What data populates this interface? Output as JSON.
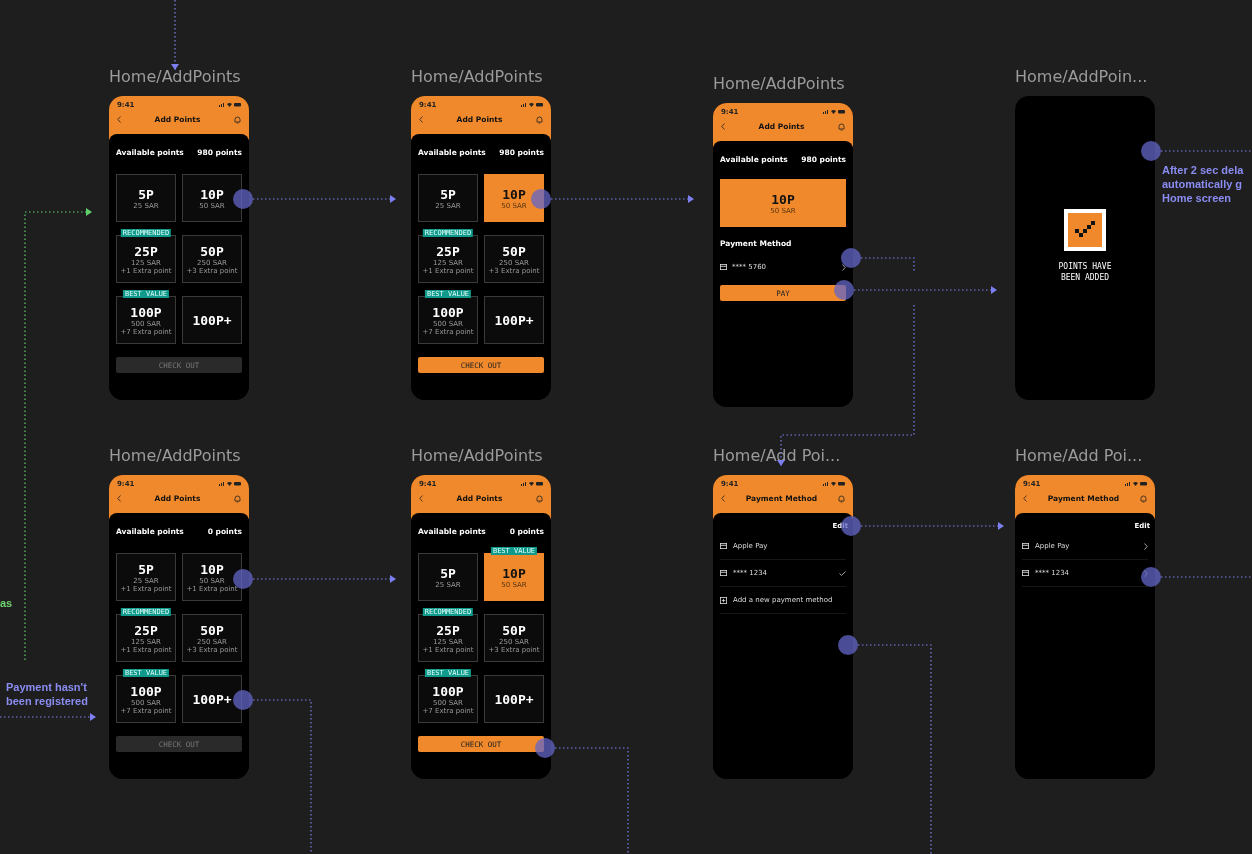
{
  "frames": [
    {
      "title": "Home/AddPoints",
      "kind": "packages",
      "time": "9:41",
      "header": "Add Points",
      "balance_label": "Available points",
      "balance": "980 points",
      "packages": [
        {
          "points": "5P",
          "price": "25 SAR",
          "selected": false
        },
        {
          "points": "10P",
          "price": "50 SAR",
          "selected": false
        },
        {
          "points": "25P",
          "price": "125 SAR",
          "extra": "+1 Extra point",
          "badge": "RECOMMENDED",
          "selected": false
        },
        {
          "points": "50P",
          "price": "250 SAR",
          "extra": "+3 Extra point",
          "selected": false
        },
        {
          "points": "100P",
          "price": "500 SAR",
          "extra": "+7 Extra point",
          "badge": "BEST VALUE",
          "selected": false
        },
        {
          "points": "100P+",
          "selected": false
        }
      ],
      "action": {
        "label": "CHECK OUT",
        "disabled": true
      }
    },
    {
      "title": "Home/AddPoints",
      "kind": "packages",
      "time": "9:41",
      "header": "Add Points",
      "balance_label": "Available points",
      "balance": "980 points",
      "packages": [
        {
          "points": "5P",
          "price": "25 SAR",
          "selected": false
        },
        {
          "points": "10P",
          "price": "50 SAR",
          "selected": true
        },
        {
          "points": "25P",
          "price": "125 SAR",
          "extra": "+1 Extra point",
          "badge": "RECOMMENDED",
          "selected": false
        },
        {
          "points": "50P",
          "price": "250 SAR",
          "extra": "+3 Extra point",
          "selected": false
        },
        {
          "points": "100P",
          "price": "500 SAR",
          "extra": "+7 Extra point",
          "badge": "BEST VALUE",
          "selected": false
        },
        {
          "points": "100P+",
          "selected": false
        }
      ],
      "action": {
        "label": "CHECK OUT",
        "disabled": false
      }
    },
    {
      "title": "Home/AddPoints",
      "kind": "pay",
      "time": "9:41",
      "header": "Add Points",
      "balance_label": "Available points",
      "balance": "980 points",
      "package": {
        "points": "10P",
        "price": "50 SAR"
      },
      "method_label": "Payment Method",
      "card": "**** 5760",
      "action": {
        "label": "PAY",
        "disabled": false
      }
    },
    {
      "title": "Home/AddPoin...",
      "kind": "success",
      "message": [
        "POINTS HAVE",
        "BEEN ADDED"
      ]
    },
    {
      "title": "Home/AddPoints",
      "kind": "packages",
      "time": "9:41",
      "header": "Add Points",
      "balance_label": "Available points",
      "balance": "0 points",
      "packages": [
        {
          "points": "5P",
          "price": "25 SAR",
          "extra": "+1 Extra point",
          "selected": false
        },
        {
          "points": "10P",
          "price": "50 SAR",
          "extra": "+1 Extra point",
          "selected": false
        },
        {
          "points": "25P",
          "price": "125 SAR",
          "extra": "+1 Extra point",
          "badge": "RECOMMENDED",
          "selected": false
        },
        {
          "points": "50P",
          "price": "250 SAR",
          "extra": "+3 Extra point",
          "selected": false
        },
        {
          "points": "100P",
          "price": "500 SAR",
          "extra": "+7 Extra point",
          "badge": "BEST VALUE",
          "selected": false
        },
        {
          "points": "100P+",
          "selected": false
        }
      ],
      "action": {
        "label": "CHECK OUT",
        "disabled": true
      }
    },
    {
      "title": "Home/AddPoints",
      "kind": "packages",
      "time": "9:41",
      "header": "Add Points",
      "balance_label": "Available points",
      "balance": "0 points",
      "packages": [
        {
          "points": "5P",
          "price": "25 SAR",
          "selected": false
        },
        {
          "points": "10P",
          "price": "50 SAR",
          "badge": "BEST VALUE",
          "selected": true
        },
        {
          "points": "25P",
          "price": "125 SAR",
          "extra": "+1 Extra point",
          "badge": "RECOMMENDED",
          "selected": false
        },
        {
          "points": "50P",
          "price": "250 SAR",
          "extra": "+3 Extra point",
          "selected": false
        },
        {
          "points": "100P",
          "price": "500 SAR",
          "extra": "+7 Extra point",
          "badge": "BEST VALUE",
          "selected": false
        },
        {
          "points": "100P+",
          "selected": false
        }
      ],
      "action": {
        "label": "CHECK OUT",
        "disabled": false
      }
    },
    {
      "title": "Home/Add Poi...",
      "kind": "methods",
      "time": "9:41",
      "header": "Payment Method",
      "edit": "Edit",
      "methods": [
        {
          "kind": "card",
          "label": "Apple Pay",
          "selected": false
        },
        {
          "kind": "card",
          "label": "**** 1234",
          "selected": true
        },
        {
          "kind": "add",
          "label": "Add a new payment method",
          "selected": false
        }
      ]
    },
    {
      "title": "Home/Add Poi...",
      "kind": "methods",
      "time": "9:41",
      "header": "Payment Method",
      "edit": "Edit",
      "methods": [
        {
          "kind": "link",
          "label": "Apple Pay"
        },
        {
          "kind": "link",
          "label": "**** 1234"
        }
      ]
    }
  ],
  "notes": [
    {
      "lines": [
        "After 2 sec dela",
        "automatically g",
        "Home screen"
      ],
      "color": "#8a8cf2"
    },
    {
      "lines": [
        "as"
      ],
      "color": "#6fd36f"
    },
    {
      "lines": [
        "Payment hasn't",
        "been registered"
      ],
      "color": "#8a8cf2"
    }
  ]
}
